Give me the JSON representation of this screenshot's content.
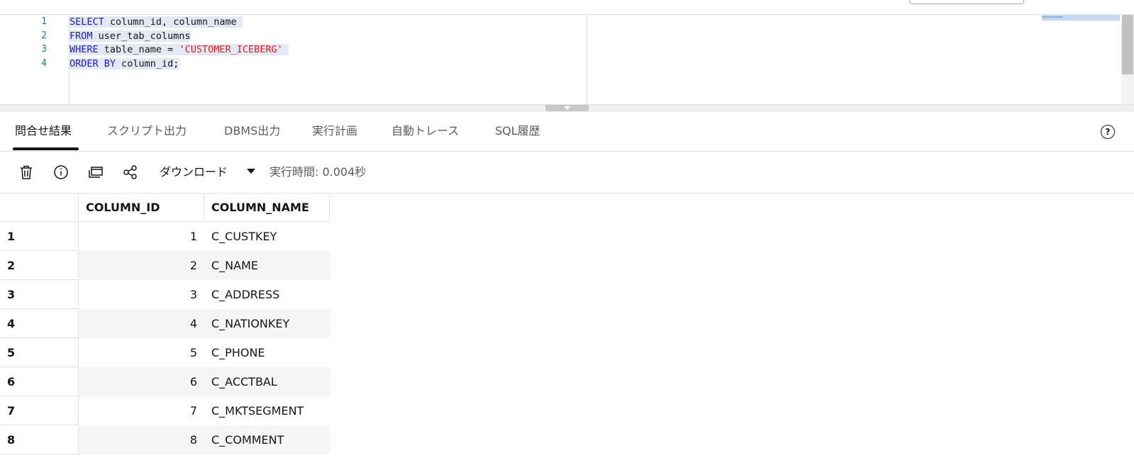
{
  "editor": {
    "line_numbers": [
      "1",
      "2",
      "3",
      "4"
    ],
    "lines": [
      {
        "kw": "SELECT",
        "rest": " column_id, column_name"
      },
      {
        "kw": "FROM",
        "rest": " user_tab_columns"
      },
      {
        "kw": "WHERE",
        "rest": " table_name = ",
        "str": "'CUSTOMER_ICEBERG'"
      },
      {
        "kw": "ORDER BY",
        "rest": " column_id;"
      }
    ]
  },
  "tabs": [
    {
      "label": "問合せ結果",
      "active": true
    },
    {
      "label": "スクリプト出力",
      "active": false
    },
    {
      "label": "DBMS出力",
      "active": false
    },
    {
      "label": "実行計画",
      "active": false
    },
    {
      "label": "自動トレース",
      "active": false
    },
    {
      "label": "SQL履歴",
      "active": false
    }
  ],
  "help_label": "?",
  "toolbar": {
    "download_label": "ダウンロード",
    "exec_time": "実行時間: 0.004秒",
    "icons": [
      "trash-icon",
      "info-icon",
      "window-icon",
      "share-icon"
    ]
  },
  "grid": {
    "columns": [
      "COLUMN_ID",
      "COLUMN_NAME"
    ],
    "rows": [
      {
        "n": "1",
        "id": "1",
        "name": "C_CUSTKEY"
      },
      {
        "n": "2",
        "id": "2",
        "name": "C_NAME"
      },
      {
        "n": "3",
        "id": "3",
        "name": "C_ADDRESS"
      },
      {
        "n": "4",
        "id": "4",
        "name": "C_NATIONKEY"
      },
      {
        "n": "5",
        "id": "5",
        "name": "C_PHONE"
      },
      {
        "n": "6",
        "id": "6",
        "name": "C_ACCTBAL"
      },
      {
        "n": "7",
        "id": "7",
        "name": "C_MKTSEGMENT"
      },
      {
        "n": "8",
        "id": "8",
        "name": "C_COMMENT"
      }
    ]
  },
  "colors": {
    "keyword": "#1a1acc",
    "string": "#e02020",
    "selection": "#e3eaf5",
    "line_number": "#237893"
  }
}
